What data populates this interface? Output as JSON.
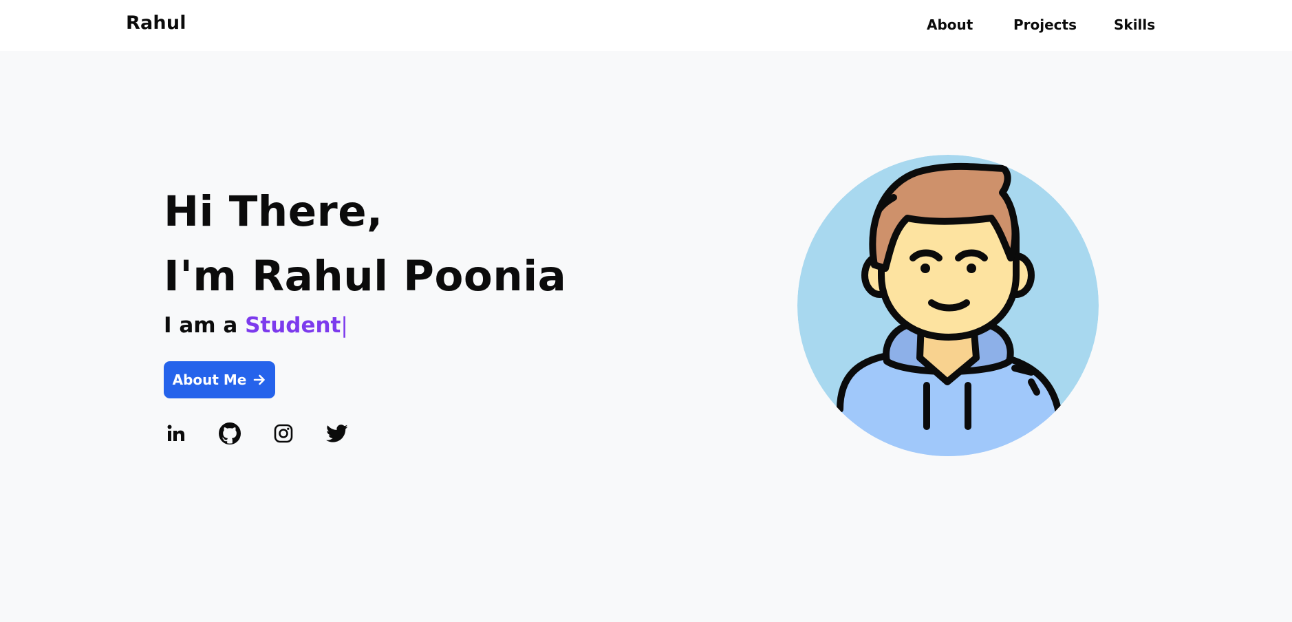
{
  "navbar": {
    "brand": "Rahul",
    "links": [
      {
        "label": "About"
      },
      {
        "label": "Projects"
      },
      {
        "label": "Skills"
      }
    ]
  },
  "hero": {
    "greeting": "Hi There,",
    "intro": "I'm Rahul Poonia",
    "tagline_prefix": "I am a ",
    "role": "Student",
    "cursor": "|",
    "cta_label": "About Me"
  },
  "socials": [
    {
      "icon": "linkedin-icon"
    },
    {
      "icon": "github-icon"
    },
    {
      "icon": "instagram-icon"
    },
    {
      "icon": "twitter-icon"
    }
  ],
  "colors": {
    "background": "#f8f9fa",
    "navbar": "#ffffff",
    "accent_button": "#2563eb",
    "role_text": "#7c3aed",
    "avatar_circle": "#a8d8ef"
  }
}
